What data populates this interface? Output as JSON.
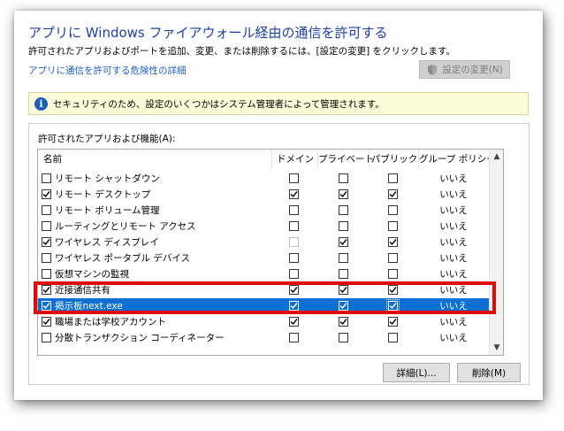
{
  "dialog": {
    "title": "アプリに Windows ファイアウォール経由の通信を許可する",
    "subtitle": "許可されたアプリおよびポートを追加、変更、または削除するには、[設定の変更] をクリックします。",
    "risk_link": "アプリに通信を許可する危険性の詳細",
    "change_settings_button": "設定の変更(N)",
    "info_message": "セキュリティのため、設定のいくつかはシステム管理者によって管理されます。",
    "list_label": "許可されたアプリおよび機能(A):",
    "details_button": "詳細(L)...",
    "remove_button": "削除(M)"
  },
  "table": {
    "headers": {
      "name": "名前",
      "domain": "ドメイン",
      "private": "プライベート",
      "public": "パブリック",
      "policy": "グループ ポリシー"
    },
    "rows": [
      {
        "name": "リモート シャットダウン",
        "enabled": false,
        "domain": false,
        "private": false,
        "public": false,
        "policy": "いいえ"
      },
      {
        "name": "リモート デスクトップ",
        "enabled": true,
        "domain": true,
        "private": true,
        "public": true,
        "policy": "いいえ"
      },
      {
        "name": "リモート ボリューム管理",
        "enabled": false,
        "domain": false,
        "private": false,
        "public": false,
        "policy": "いいえ"
      },
      {
        "name": "ルーティングとリモート アクセス",
        "enabled": false,
        "domain": false,
        "private": false,
        "public": false,
        "policy": "いいえ"
      },
      {
        "name": "ワイヤレス ディスプレイ",
        "enabled": true,
        "domain": false,
        "private": true,
        "public": true,
        "policy": "いいえ"
      },
      {
        "name": "ワイヤレス ポータブル デバイス",
        "enabled": false,
        "domain": false,
        "private": false,
        "public": false,
        "policy": "いいえ"
      },
      {
        "name": "仮想マシンの監視",
        "enabled": false,
        "domain": false,
        "private": false,
        "public": false,
        "policy": "いいえ"
      },
      {
        "name": "近接通信共有",
        "enabled": true,
        "domain": true,
        "private": true,
        "public": true,
        "policy": "いいえ"
      },
      {
        "name": "掲示板next.exe",
        "enabled": true,
        "domain": true,
        "private": true,
        "public": true,
        "policy": "いいえ"
      },
      {
        "name": "職場または学校アカウント",
        "enabled": true,
        "domain": true,
        "private": true,
        "public": true,
        "policy": "いいえ"
      },
      {
        "name": "分散トランザクション コーディネーター",
        "enabled": false,
        "domain": false,
        "private": false,
        "public": false,
        "policy": "いいえ"
      }
    ]
  },
  "colors": {
    "title": "#1e3f9e",
    "link": "#1f5fbf",
    "selection": "#0b6fd3",
    "highlight_box": "#e00a0a",
    "info_background": "#fcfcd8"
  }
}
